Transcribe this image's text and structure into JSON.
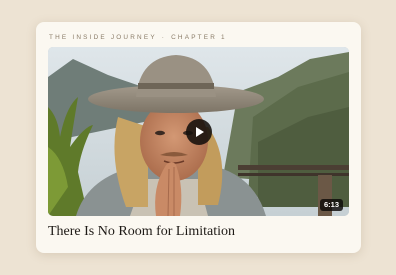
{
  "card": {
    "series": "THE INSIDE JOURNEY",
    "separator": "·",
    "chapter": "CHAPTER 1",
    "video": {
      "duration": "6:13",
      "play_icon": "play-icon"
    },
    "title": "There Is No Room for Limitation"
  },
  "colors": {
    "page_background": "#ede3d3",
    "card_background": "#fbf8f1",
    "eyebrow_text": "#8a7c68",
    "title_text": "#1e1a16"
  }
}
